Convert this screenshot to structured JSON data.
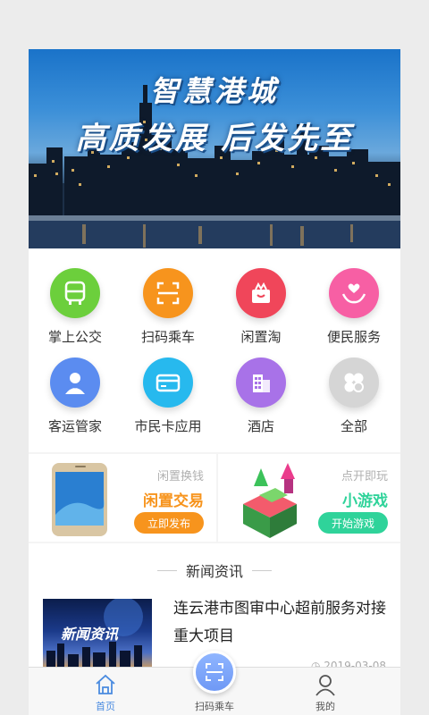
{
  "banner": {
    "line1": "智慧港城",
    "line2": "高质发展 后发先至"
  },
  "services": [
    {
      "label": "掌上公交",
      "icon": "bus-icon",
      "color": "#6ccf3c"
    },
    {
      "label": "扫码乘车",
      "icon": "scan-ride-icon",
      "color": "#f7941d"
    },
    {
      "label": "闲置淘",
      "icon": "gift-box-icon",
      "color": "#f0465a"
    },
    {
      "label": "便民服务",
      "icon": "heart-hands-icon",
      "color": "#f75fa4"
    },
    {
      "label": "客运管家",
      "icon": "steward-icon",
      "color": "#5b8cf0"
    },
    {
      "label": "市民卡应用",
      "icon": "card-icon",
      "color": "#27b9ee"
    },
    {
      "label": "酒店",
      "icon": "hotel-icon",
      "color": "#a872e8"
    },
    {
      "label": "全部",
      "icon": "all-apps-icon",
      "color": "#d5d5d5"
    }
  ],
  "promo": {
    "left": {
      "sub": "闲置换钱",
      "main": "闲置交易",
      "button": "立即发布",
      "accent": "#f7941d"
    },
    "right": {
      "sub": "点开即玩",
      "main": "小游戏",
      "button": "开始游戏",
      "accent": "#2fd39a"
    }
  },
  "news": {
    "heading": "新闻资讯",
    "items": [
      {
        "image_text": "新闻资讯",
        "title": "连云港市图审中心超前服务对接重大项目",
        "date": "2019-03-08"
      }
    ]
  },
  "tabbar": [
    {
      "label": "首页",
      "icon": "home-icon",
      "active": true
    },
    {
      "label": "扫码乘车",
      "icon": "scan-icon",
      "active": false
    },
    {
      "label": "我的",
      "icon": "user-icon",
      "active": false
    }
  ]
}
